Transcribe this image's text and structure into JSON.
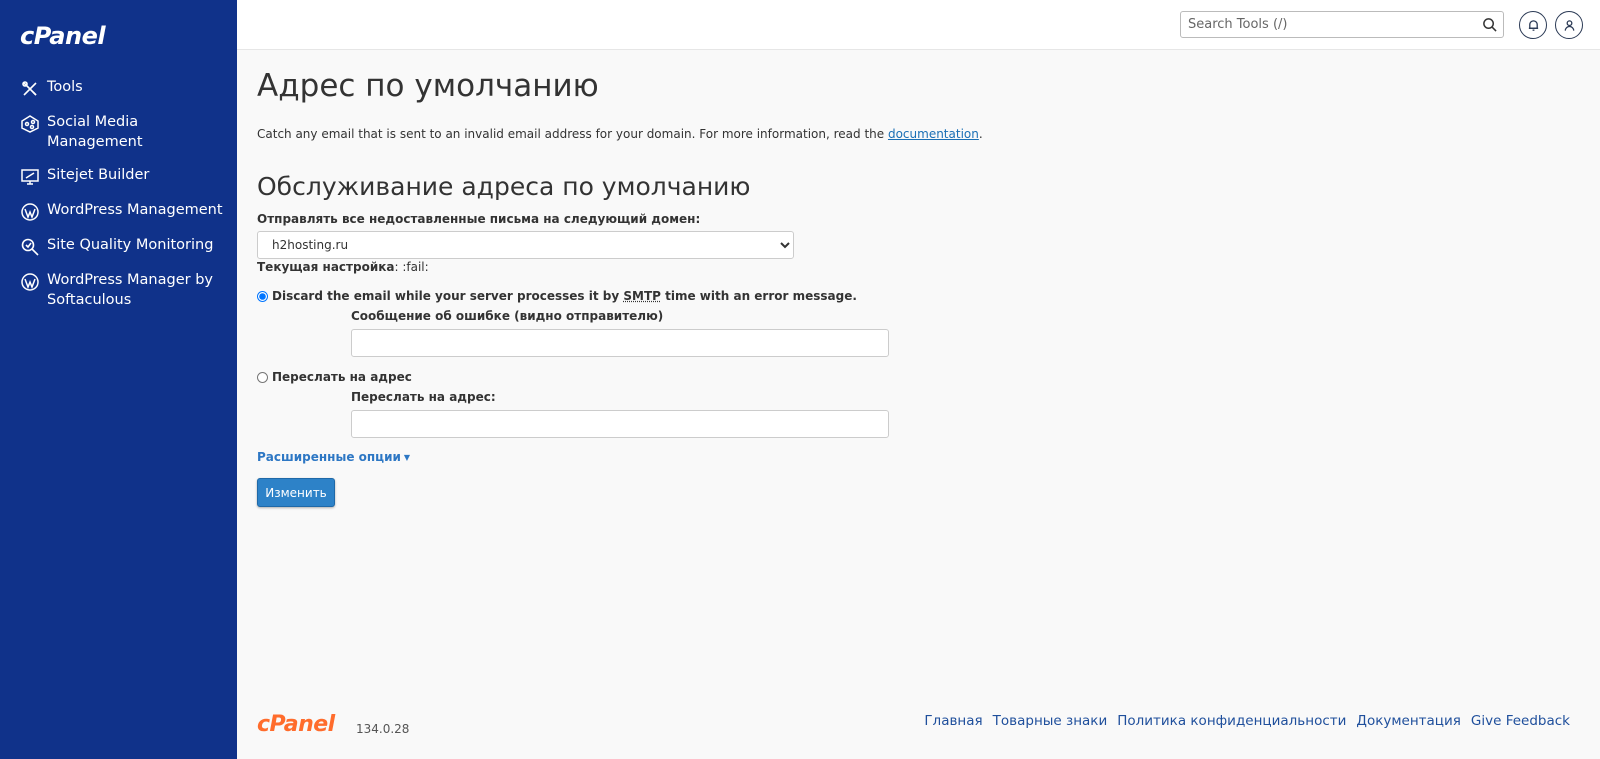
{
  "app": {
    "logo_text": "cPanel",
    "accent_color": "#10328a"
  },
  "sidebar": {
    "items": [
      {
        "label": "Tools",
        "icon": "tools-icon"
      },
      {
        "label": "Social Media Management",
        "icon": "social-media-icon"
      },
      {
        "label": "Sitejet Builder",
        "icon": "sitejet-icon"
      },
      {
        "label": "WordPress Management",
        "icon": "wordpress-icon"
      },
      {
        "label": "Site Quality Monitoring",
        "icon": "magnifier-icon"
      },
      {
        "label": "WordPress Manager by Softaculous",
        "icon": "wordpress-icon"
      }
    ]
  },
  "topbar": {
    "search_placeholder": "Search Tools (/)",
    "notifications_icon": "bell-icon",
    "user_icon": "user-icon"
  },
  "main": {
    "page_title": "Адрес по умолчанию",
    "intro_text": "Catch any email that is sent to an invalid email address for your domain. For more information, read the",
    "intro_link": "documentation",
    "intro_end": ".",
    "section_title": "Обслуживание адреса по умолчанию",
    "domain_label": "Отправлять все недоставленные письма на следующий домен:",
    "domain_value": "h2hosting.ru",
    "current_label": "Текущая настройка",
    "current_value": ": :fail:",
    "option_discard_pre": "Discard the email while your server processes it by",
    "option_discard_abbr": "SMTP",
    "option_discard_post": "time with an error message.",
    "error_message_label": "Сообщение об ошибке (видно отправителю)",
    "error_message_value": "",
    "option_forward": "Переслать на адрес",
    "forward_label": "Переслать на адрес:",
    "forward_value": "",
    "advanced_options": "Расширенные опции",
    "submit_label": "Изменить"
  },
  "footer": {
    "logo_text": "cPanel",
    "version": "134.0.28",
    "links": [
      "Главная",
      "Товарные знаки",
      "Политика конфиденциальности",
      "Документация",
      "Give Feedback"
    ]
  }
}
